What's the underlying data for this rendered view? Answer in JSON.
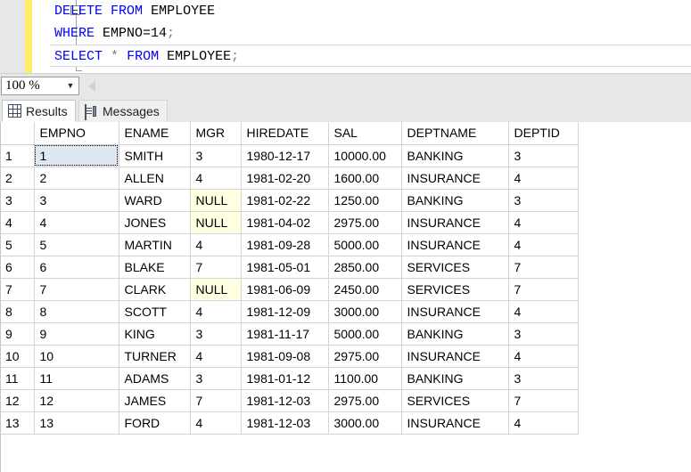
{
  "editor": {
    "lines": [
      {
        "id": "line-delete",
        "current": false,
        "tokens": [
          {
            "text": "DELETE",
            "type": "kw"
          },
          {
            "text": " ",
            "type": "id"
          },
          {
            "text": "FROM",
            "type": "kw"
          },
          {
            "text": " ",
            "type": "id"
          },
          {
            "text": "EMPLOYEE",
            "type": "id"
          }
        ],
        "plain": "DELETE FROM EMPLOYEE"
      },
      {
        "id": "line-where",
        "current": false,
        "tokens": [
          {
            "text": "WHERE",
            "type": "kw"
          },
          {
            "text": " EMPNO=",
            "type": "id"
          },
          {
            "text": "14",
            "type": "num"
          },
          {
            "text": ";",
            "type": "punct"
          }
        ],
        "plain": "WHERE EMPNO=14;"
      },
      {
        "id": "line-select",
        "current": true,
        "tokens": [
          {
            "text": "SELECT",
            "type": "kw"
          },
          {
            "text": " ",
            "type": "id"
          },
          {
            "text": "*",
            "type": "star"
          },
          {
            "text": " ",
            "type": "id"
          },
          {
            "text": "FROM",
            "type": "kw"
          },
          {
            "text": " EMPLOYEE",
            "type": "id"
          },
          {
            "text": ";",
            "type": "punct"
          }
        ],
        "plain": "SELECT * FROM EMPLOYEE;"
      }
    ]
  },
  "zoom_bar": {
    "zoom_level": "100 %",
    "dropdown_glyph": "▼",
    "splitter_icon": "collapse-left-arrow-icon"
  },
  "tabs": [
    {
      "id": "tab-results",
      "label": "Results",
      "icon": "grid-icon",
      "active": true
    },
    {
      "id": "tab-messages",
      "label": "Messages",
      "icon": "message-document-icon",
      "active": false
    }
  ],
  "grid": {
    "columns": [
      "EMPNO",
      "ENAME",
      "MGR",
      "HIREDATE",
      "SAL",
      "DEPTNAME",
      "DEPTID"
    ],
    "selected_cell": {
      "row": 1,
      "column": "EMPNO"
    },
    "null_text": "NULL",
    "rows": [
      {
        "n": "1",
        "EMPNO": "1",
        "ENAME": "SMITH",
        "MGR": "3",
        "HIREDATE": "1980-12-17",
        "SAL": "10000.00",
        "DEPTNAME": "BANKING",
        "DEPTID": "3"
      },
      {
        "n": "2",
        "EMPNO": "2",
        "ENAME": "ALLEN",
        "MGR": "4",
        "HIREDATE": "1981-02-20",
        "SAL": "1600.00",
        "DEPTNAME": "INSURANCE",
        "DEPTID": "4"
      },
      {
        "n": "3",
        "EMPNO": "3",
        "ENAME": "WARD",
        "MGR": "NULL",
        "HIREDATE": "1981-02-22",
        "SAL": "1250.00",
        "DEPTNAME": "BANKING",
        "DEPTID": "3"
      },
      {
        "n": "4",
        "EMPNO": "4",
        "ENAME": "JONES",
        "MGR": "NULL",
        "HIREDATE": "1981-04-02",
        "SAL": "2975.00",
        "DEPTNAME": "INSURANCE",
        "DEPTID": "4"
      },
      {
        "n": "5",
        "EMPNO": "5",
        "ENAME": "MARTIN",
        "MGR": "4",
        "HIREDATE": "1981-09-28",
        "SAL": "5000.00",
        "DEPTNAME": "INSURANCE",
        "DEPTID": "4"
      },
      {
        "n": "6",
        "EMPNO": "6",
        "ENAME": "BLAKE",
        "MGR": "7",
        "HIREDATE": "1981-05-01",
        "SAL": "2850.00",
        "DEPTNAME": "SERVICES",
        "DEPTID": "7"
      },
      {
        "n": "7",
        "EMPNO": "7",
        "ENAME": "CLARK",
        "MGR": "NULL",
        "HIREDATE": "1981-06-09",
        "SAL": "2450.00",
        "DEPTNAME": "SERVICES",
        "DEPTID": "7"
      },
      {
        "n": "8",
        "EMPNO": "8",
        "ENAME": "SCOTT",
        "MGR": "4",
        "HIREDATE": "1981-12-09",
        "SAL": "3000.00",
        "DEPTNAME": "INSURANCE",
        "DEPTID": "4"
      },
      {
        "n": "9",
        "EMPNO": "9",
        "ENAME": "KING",
        "MGR": "3",
        "HIREDATE": "1981-11-17",
        "SAL": "5000.00",
        "DEPTNAME": "BANKING",
        "DEPTID": "3"
      },
      {
        "n": "10",
        "EMPNO": "10",
        "ENAME": "TURNER",
        "MGR": "4",
        "HIREDATE": "1981-09-08",
        "SAL": "2975.00",
        "DEPTNAME": "INSURANCE",
        "DEPTID": "4"
      },
      {
        "n": "11",
        "EMPNO": "11",
        "ENAME": "ADAMS",
        "MGR": "3",
        "HIREDATE": "1981-01-12",
        "SAL": "1100.00",
        "DEPTNAME": "BANKING",
        "DEPTID": "3"
      },
      {
        "n": "12",
        "EMPNO": "12",
        "ENAME": "JAMES",
        "MGR": "7",
        "HIREDATE": "1981-12-03",
        "SAL": "2975.00",
        "DEPTNAME": "SERVICES",
        "DEPTID": "7"
      },
      {
        "n": "13",
        "EMPNO": "13",
        "ENAME": "FORD",
        "MGR": "4",
        "HIREDATE": "1981-12-03",
        "SAL": "3000.00",
        "DEPTNAME": "INSURANCE",
        "DEPTID": "4"
      }
    ]
  },
  "colors": {
    "keyword": "#0000ff",
    "change_bar": "#ffee62",
    "null_cell_bg": "#ffffe1",
    "selected_cell_bg": "#dfe8f0",
    "chrome": "#e6e7e8"
  }
}
